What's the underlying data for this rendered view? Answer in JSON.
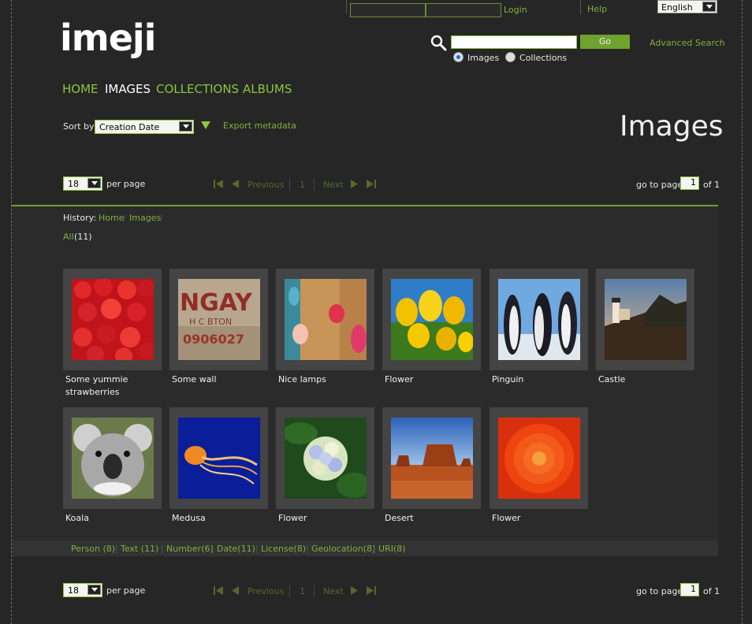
{
  "header": {
    "login_label": "Login",
    "help_label": "Help",
    "language": "English",
    "logo_text": "imeji"
  },
  "search": {
    "go_label": "Go",
    "advanced_label": "Advanced Search",
    "scope_options": [
      "Images",
      "Collections"
    ],
    "scope_selected": "Images"
  },
  "nav": {
    "items": [
      "HOME",
      "IMAGES",
      "COLLECTIONS",
      "ALBUMS"
    ],
    "active": "IMAGES"
  },
  "toolbar": {
    "sort_label": "Sort by",
    "sort_value": "Creation Date",
    "export_label": "Export metadata",
    "page_title": "Images"
  },
  "pager": {
    "per_page_value": "18",
    "per_page_label": "per page",
    "previous_label": "Previous",
    "current_page": "1",
    "next_label": "Next",
    "goto_label": "go to page",
    "goto_value": "1",
    "of_label": "of 1"
  },
  "history": {
    "label": "History:",
    "crumbs": [
      "Home",
      "Images"
    ]
  },
  "filter": {
    "all_label": "All",
    "count": "(11)"
  },
  "images": [
    {
      "caption": "Some yummie strawberries",
      "icon": "strawberries-image"
    },
    {
      "caption": "Some wall",
      "icon": "wall-image"
    },
    {
      "caption": "Nice lamps",
      "icon": "lamps-image"
    },
    {
      "caption": "Flower",
      "icon": "tulips-image"
    },
    {
      "caption": "Pinguin",
      "icon": "penguins-image"
    },
    {
      "caption": "Castle",
      "icon": "lighthouse-image"
    },
    {
      "caption": "Koala",
      "icon": "koala-image"
    },
    {
      "caption": "Medusa",
      "icon": "jellyfish-image"
    },
    {
      "caption": "Flower",
      "icon": "hydrangea-image"
    },
    {
      "caption": "Desert",
      "icon": "desert-image"
    },
    {
      "caption": "Flower",
      "icon": "chrysanthemum-image"
    }
  ],
  "facets": [
    "Person (8)",
    "Text (11)",
    "Number(6)",
    "Date(11)",
    "License(8)",
    "Geolocation(8)",
    "URI(8)"
  ],
  "colors": {
    "accent": "#8cc63f",
    "background": "#262626",
    "tile": "#444444"
  }
}
